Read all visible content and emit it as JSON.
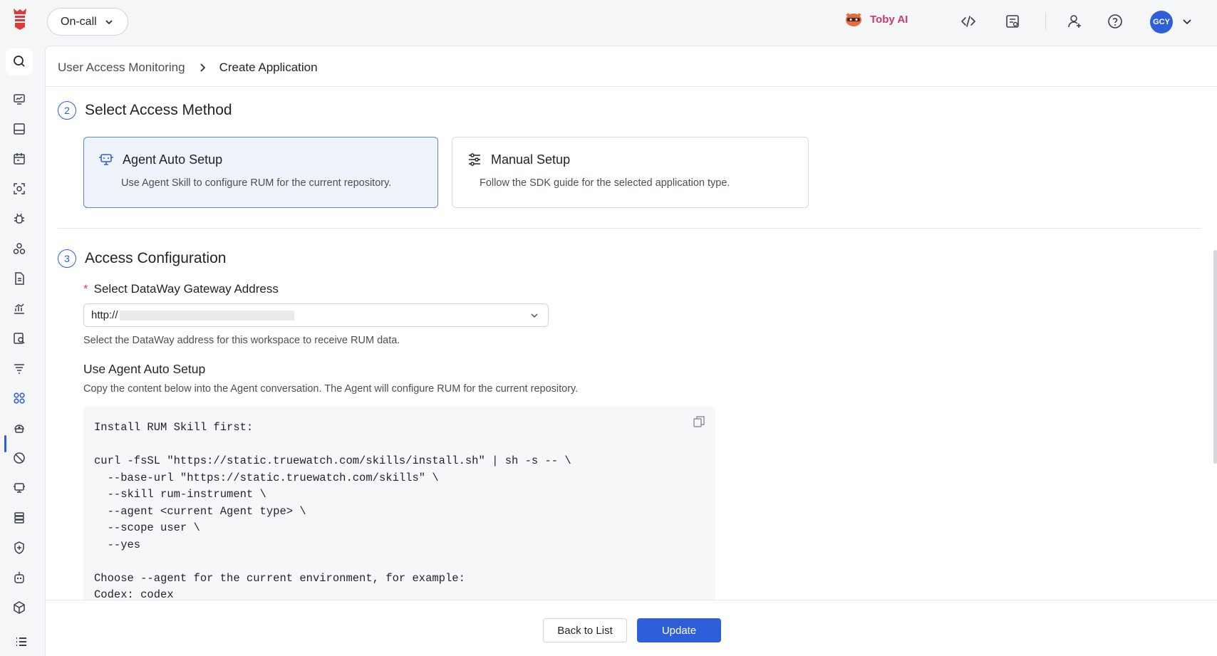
{
  "header": {
    "workspace": "On-call",
    "ai_label": "Toby AI",
    "avatar_initials": "GCY",
    "icons": [
      "code-icon",
      "notes-icon",
      "add-user-icon",
      "help-icon"
    ]
  },
  "sidebar": {
    "items": [
      "search-icon",
      "monitor-icon",
      "dashboard-icon",
      "calendar-icon",
      "scan-icon",
      "bug-icon",
      "infrastructure-icon",
      "document-icon",
      "metrics-icon",
      "log-search-icon",
      "pipeline-icon",
      "apps-icon",
      "synthetic-icon",
      "block-icon",
      "device-icon",
      "database-icon",
      "security-icon",
      "robot-icon",
      "cube-icon",
      "menu-icon"
    ],
    "active": "apps-icon"
  },
  "breadcrumb": {
    "parent": "User Access Monitoring",
    "current": "Create Application"
  },
  "steps": {
    "access_method": {
      "number": "2",
      "title": "Select Access Method"
    },
    "access_config": {
      "number": "3",
      "title": "Access Configuration"
    }
  },
  "cards": {
    "agent": {
      "title": "Agent Auto Setup",
      "desc": "Use Agent Skill to configure RUM for the current repository."
    },
    "manual": {
      "title": "Manual Setup",
      "desc": "Follow the SDK guide for the selected application type."
    }
  },
  "gateway": {
    "label": "Select DataWay Gateway Address",
    "value": "http://",
    "hint": "Select the DataWay address for this workspace to receive RUM data."
  },
  "auto_setup": {
    "title": "Use Agent Auto Setup",
    "desc": "Copy the content below into the Agent conversation. The Agent will configure RUM for the current repository.",
    "code": "Install RUM Skill first:\n\ncurl -fsSL \"https://static.truewatch.com/skills/install.sh\" | sh -s -- \\\n  --base-url \"https://static.truewatch.com/skills\" \\\n  --skill rum-instrument \\\n  --agent <current Agent type> \\\n  --scope user \\\n  --yes\n\nChoose --agent for the current environment, for example:\nCodex: codex"
  },
  "footer": {
    "back_label": "Back to List",
    "update_label": "Update"
  },
  "colors": {
    "accent": "#2f5fd8",
    "ai_brand": "#c83d6b",
    "required": "#e54545"
  }
}
